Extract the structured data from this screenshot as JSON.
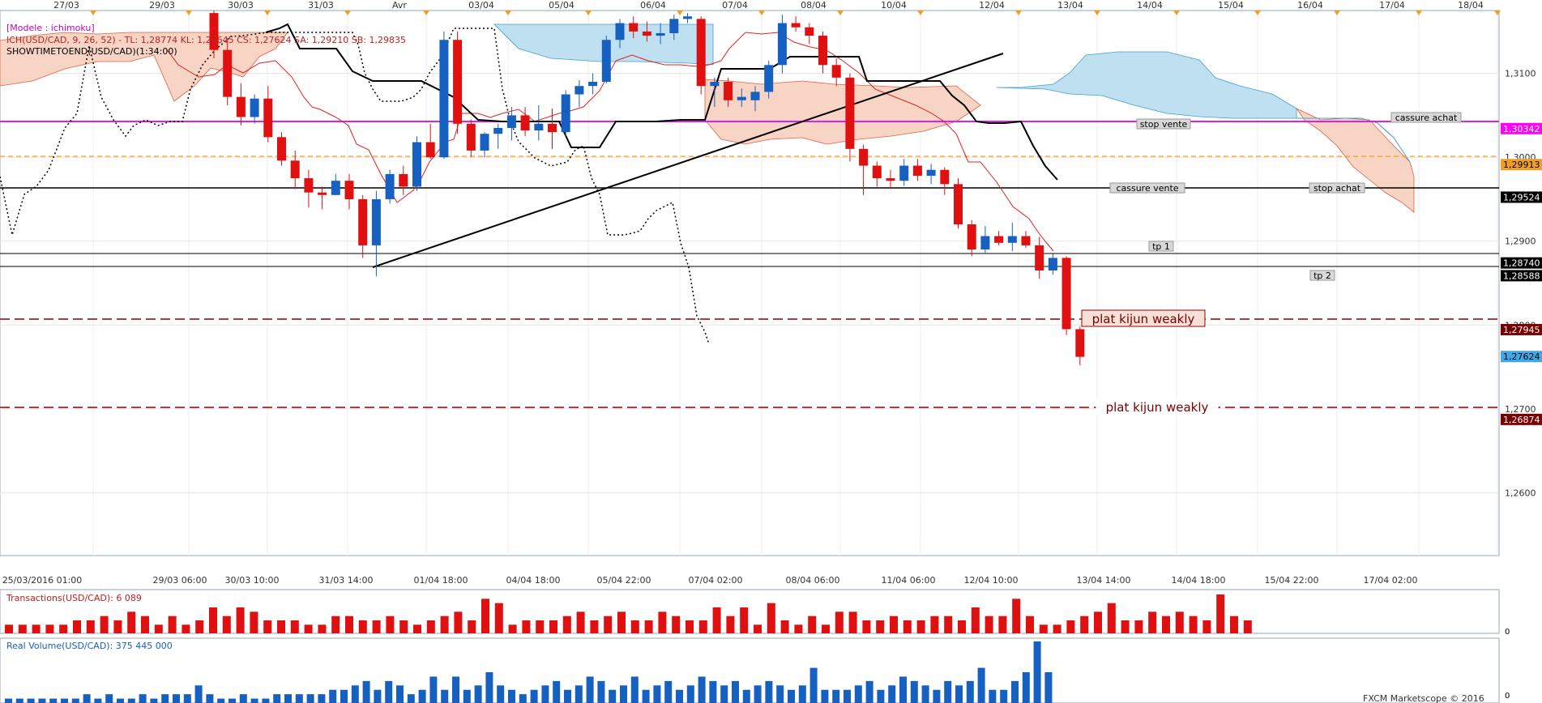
{
  "header": {
    "model": "[Modele : ichimoku]",
    "ich_legend": "ICH(USD/CAD, 9, 26, 52) -  TL: 1,28774  KL: 1,29645  CS: 1,27624  SA: 1,29210  SB: 1,29835",
    "showtime": "SHOWTIMETOEND(USD/CAD)(1:34:00)"
  },
  "top_dates": [
    "27/03",
    "29/03",
    "30/03",
    "31/03",
    "Avr",
    "03/04",
    "05/04",
    "06/04",
    "07/04",
    "08/04",
    "10/04",
    "12/04",
    "13/04",
    "14/04",
    "15/04",
    "16/04",
    "17/04",
    "18/04"
  ],
  "bottom_dates": [
    "25/03/2016 01:00",
    "29/03 06:00",
    "30/03 10:00",
    "31/03 14:00",
    "01/04 18:00",
    "04/04 18:00",
    "05/04 22:00",
    "07/04 02:00",
    "08/04 06:00",
    "11/04 06:00",
    "12/04 10:00",
    "13/04 14:00",
    "14/04 18:00",
    "15/04 22:00",
    "17/04 02:00"
  ],
  "price_ticks": [
    "1,3100",
    "1,3000",
    "1,2900",
    "1,2800",
    "1,2700",
    "1,2600"
  ],
  "price_labels": [
    {
      "text": "1,30342",
      "value": 1.30342,
      "bg": "#ff00ff",
      "fg": "#ffffff"
    },
    {
      "text": "1,29913",
      "value": 1.29913,
      "bg": "#f0a020",
      "fg": "#000000"
    },
    {
      "text": "1,29524",
      "value": 1.29524,
      "bg": "#000000",
      "fg": "#ffffff"
    },
    {
      "text": "1,28740",
      "value": 1.2874,
      "bg": "#000000",
      "fg": "#ffffff"
    },
    {
      "text": "1,28588",
      "value": 1.28588,
      "bg": "#000000",
      "fg": "#ffffff"
    },
    {
      "text": "1,27945",
      "value": 1.27945,
      "bg": "#7a0000",
      "fg": "#ffffff"
    },
    {
      "text": "1,27624",
      "value": 1.27624,
      "bg": "#3fa8e8",
      "fg": "#000000"
    },
    {
      "text": "1,26874",
      "value": 1.26874,
      "bg": "#7a0000",
      "fg": "#ffffff"
    }
  ],
  "annotations": {
    "stop_vente": "stop vente",
    "cassure_achat": "cassure achat",
    "cassure_vente": "cassure vente",
    "stop_achat": "stop achat",
    "tp1": "tp 1",
    "tp2": "tp 2",
    "kijun1": "plat kijun weakly",
    "kijun2": "plat kijun weakly"
  },
  "transactions_label": "Transactions(USD/CAD): 6 089",
  "volume_label": "Real Volume(USD/CAD): 375 445 000",
  "zero_label": "0",
  "footer": "FXCM Marketscope © 2016",
  "colors": {
    "bull": "#1560c0",
    "bear": "#e01010",
    "cloud_bull": "#bfe0f0",
    "cloud_bear": "#f7d4c4",
    "tenkan": "#e02020",
    "kijun": "#000000",
    "magenta": "#e020e0",
    "orange": "#f0a020",
    "darkred": "#900000"
  },
  "chart_data": {
    "type": "candlestick",
    "y_range": [
      1.2525,
      1.3175
    ],
    "candles": [
      [
        1.3172,
        1.3175,
        1.3118,
        1.3128
      ],
      [
        1.3128,
        1.3142,
        1.3062,
        1.3072
      ],
      [
        1.3072,
        1.3088,
        1.3038,
        1.3048
      ],
      [
        1.3048,
        1.3075,
        1.304,
        1.307
      ],
      [
        1.307,
        1.3085,
        1.3018,
        1.3024
      ],
      [
        1.3024,
        1.303,
        1.299,
        1.2996
      ],
      [
        1.2996,
        1.3008,
        1.2962,
        1.2975
      ],
      [
        1.2975,
        1.2985,
        1.294,
        1.2958
      ],
      [
        1.2958,
        1.2965,
        1.2938,
        1.2955
      ],
      [
        1.2955,
        1.298,
        1.2955,
        1.2972
      ],
      [
        1.2972,
        1.298,
        1.2938,
        1.295
      ],
      [
        1.295,
        1.2955,
        1.288,
        1.2895
      ],
      [
        1.2895,
        1.296,
        1.2858,
        1.295
      ],
      [
        1.295,
        1.2985,
        1.2945,
        1.298
      ],
      [
        1.298,
        1.299,
        1.2955,
        1.2965
      ],
      [
        1.2965,
        1.3025,
        1.296,
        1.3018
      ],
      [
        1.3018,
        1.304,
        1.2998,
        1.3
      ],
      [
        1.3,
        1.315,
        1.2998,
        1.314
      ],
      [
        1.314,
        1.315,
        1.3028,
        1.304
      ],
      [
        1.304,
        1.3045,
        1.3,
        1.3008
      ],
      [
        1.3008,
        1.303,
        1.3,
        1.3028
      ],
      [
        1.3028,
        1.304,
        1.301,
        1.3035
      ],
      [
        1.3035,
        1.306,
        1.302,
        1.305
      ],
      [
        1.305,
        1.306,
        1.3025,
        1.3032
      ],
      [
        1.3032,
        1.3062,
        1.302,
        1.304
      ],
      [
        1.304,
        1.3058,
        1.301,
        1.303
      ],
      [
        1.303,
        1.308,
        1.3025,
        1.3075
      ],
      [
        1.3075,
        1.3092,
        1.306,
        1.3085
      ],
      [
        1.3085,
        1.31,
        1.3075,
        1.309
      ],
      [
        1.309,
        1.3145,
        1.3088,
        1.314
      ],
      [
        1.314,
        1.3165,
        1.313,
        1.316
      ],
      [
        1.316,
        1.3168,
        1.3142,
        1.315
      ],
      [
        1.315,
        1.3162,
        1.3138,
        1.3145
      ],
      [
        1.3145,
        1.316,
        1.3135,
        1.3148
      ],
      [
        1.3148,
        1.317,
        1.314,
        1.3165
      ],
      [
        1.3165,
        1.3172,
        1.316,
        1.3168
      ],
      [
        1.3165,
        1.3168,
        1.3075,
        1.3085
      ],
      [
        1.3085,
        1.3095,
        1.306,
        1.309
      ],
      [
        1.309,
        1.3095,
        1.306,
        1.3068
      ],
      [
        1.3068,
        1.3082,
        1.306,
        1.3072
      ],
      [
        1.3068,
        1.3085,
        1.3055,
        1.3078
      ],
      [
        1.3078,
        1.3115,
        1.307,
        1.311
      ],
      [
        1.311,
        1.317,
        1.31,
        1.316
      ],
      [
        1.316,
        1.3168,
        1.315,
        1.3155
      ],
      [
        1.3155,
        1.316,
        1.3135,
        1.3145
      ],
      [
        1.3145,
        1.315,
        1.31,
        1.311
      ],
      [
        1.311,
        1.3118,
        1.3085,
        1.3095
      ],
      [
        1.3095,
        1.31,
        1.2995,
        1.301
      ],
      [
        1.301,
        1.3015,
        1.2955,
        1.299
      ],
      [
        1.299,
        1.2995,
        1.2965,
        1.2975
      ],
      [
        1.2975,
        1.2985,
        1.2962,
        1.2972
      ],
      [
        1.2972,
        1.2998,
        1.2966,
        1.299
      ],
      [
        1.299,
        1.2998,
        1.2972,
        1.2978
      ],
      [
        1.2978,
        1.2992,
        1.2968,
        1.2985
      ],
      [
        1.2985,
        1.2988,
        1.2955,
        1.2968
      ],
      [
        1.2968,
        1.2975,
        1.2915,
        1.292
      ],
      [
        1.292,
        1.2925,
        1.2882,
        1.289
      ],
      [
        1.289,
        1.2918,
        1.2885,
        1.2906
      ],
      [
        1.2906,
        1.2912,
        1.2895,
        1.2898
      ],
      [
        1.2898,
        1.2922,
        1.2888,
        1.2906
      ],
      [
        1.2906,
        1.2912,
        1.2892,
        1.2895
      ],
      [
        1.2895,
        1.2905,
        1.2855,
        1.2865
      ],
      [
        1.2865,
        1.2885,
        1.286,
        1.288
      ],
      [
        1.288,
        1.2882,
        1.2788,
        1.2795
      ],
      [
        1.2795,
        1.2798,
        1.2752,
        1.2762
      ]
    ],
    "transactions": [
      2,
      2,
      2,
      2,
      2,
      3,
      3,
      4,
      3,
      5,
      4,
      2,
      4,
      2,
      3,
      6,
      4,
      6,
      5,
      3,
      3,
      3,
      2,
      2,
      4,
      4,
      3,
      3,
      4,
      3,
      2,
      3,
      4,
      5,
      3,
      8,
      7,
      2,
      3,
      3,
      3,
      4,
      5,
      3,
      4,
      5,
      3,
      3,
      5,
      4,
      3,
      3,
      6,
      4,
      6,
      2,
      7,
      3,
      2,
      4,
      2,
      5,
      5,
      3,
      3,
      4,
      3,
      3,
      4,
      4,
      3,
      6,
      4,
      4,
      8,
      4,
      2,
      2,
      3,
      4,
      5,
      7,
      3,
      3,
      5,
      4,
      5,
      4,
      3,
      9,
      4,
      3
    ],
    "volume": [
      1,
      1,
      1,
      1,
      1,
      1,
      1,
      2,
      1,
      2,
      1,
      1,
      2,
      1,
      2,
      2,
      2,
      4,
      2,
      1,
      1,
      2,
      1,
      1,
      2,
      2,
      2,
      2,
      2,
      3,
      3,
      4,
      5,
      3,
      5,
      4,
      2,
      3,
      6,
      3,
      6,
      3,
      4,
      7,
      4,
      3,
      2,
      3,
      4,
      5,
      3,
      4,
      6,
      5,
      3,
      4,
      6,
      3,
      4,
      5,
      3,
      4,
      6,
      5,
      4,
      5,
      3,
      4,
      5,
      4,
      3,
      4,
      8,
      3,
      3,
      3,
      4,
      5,
      3,
      4,
      6,
      5,
      4,
      3,
      5,
      4,
      5,
      8,
      3,
      3,
      5,
      7,
      14,
      7
    ]
  }
}
